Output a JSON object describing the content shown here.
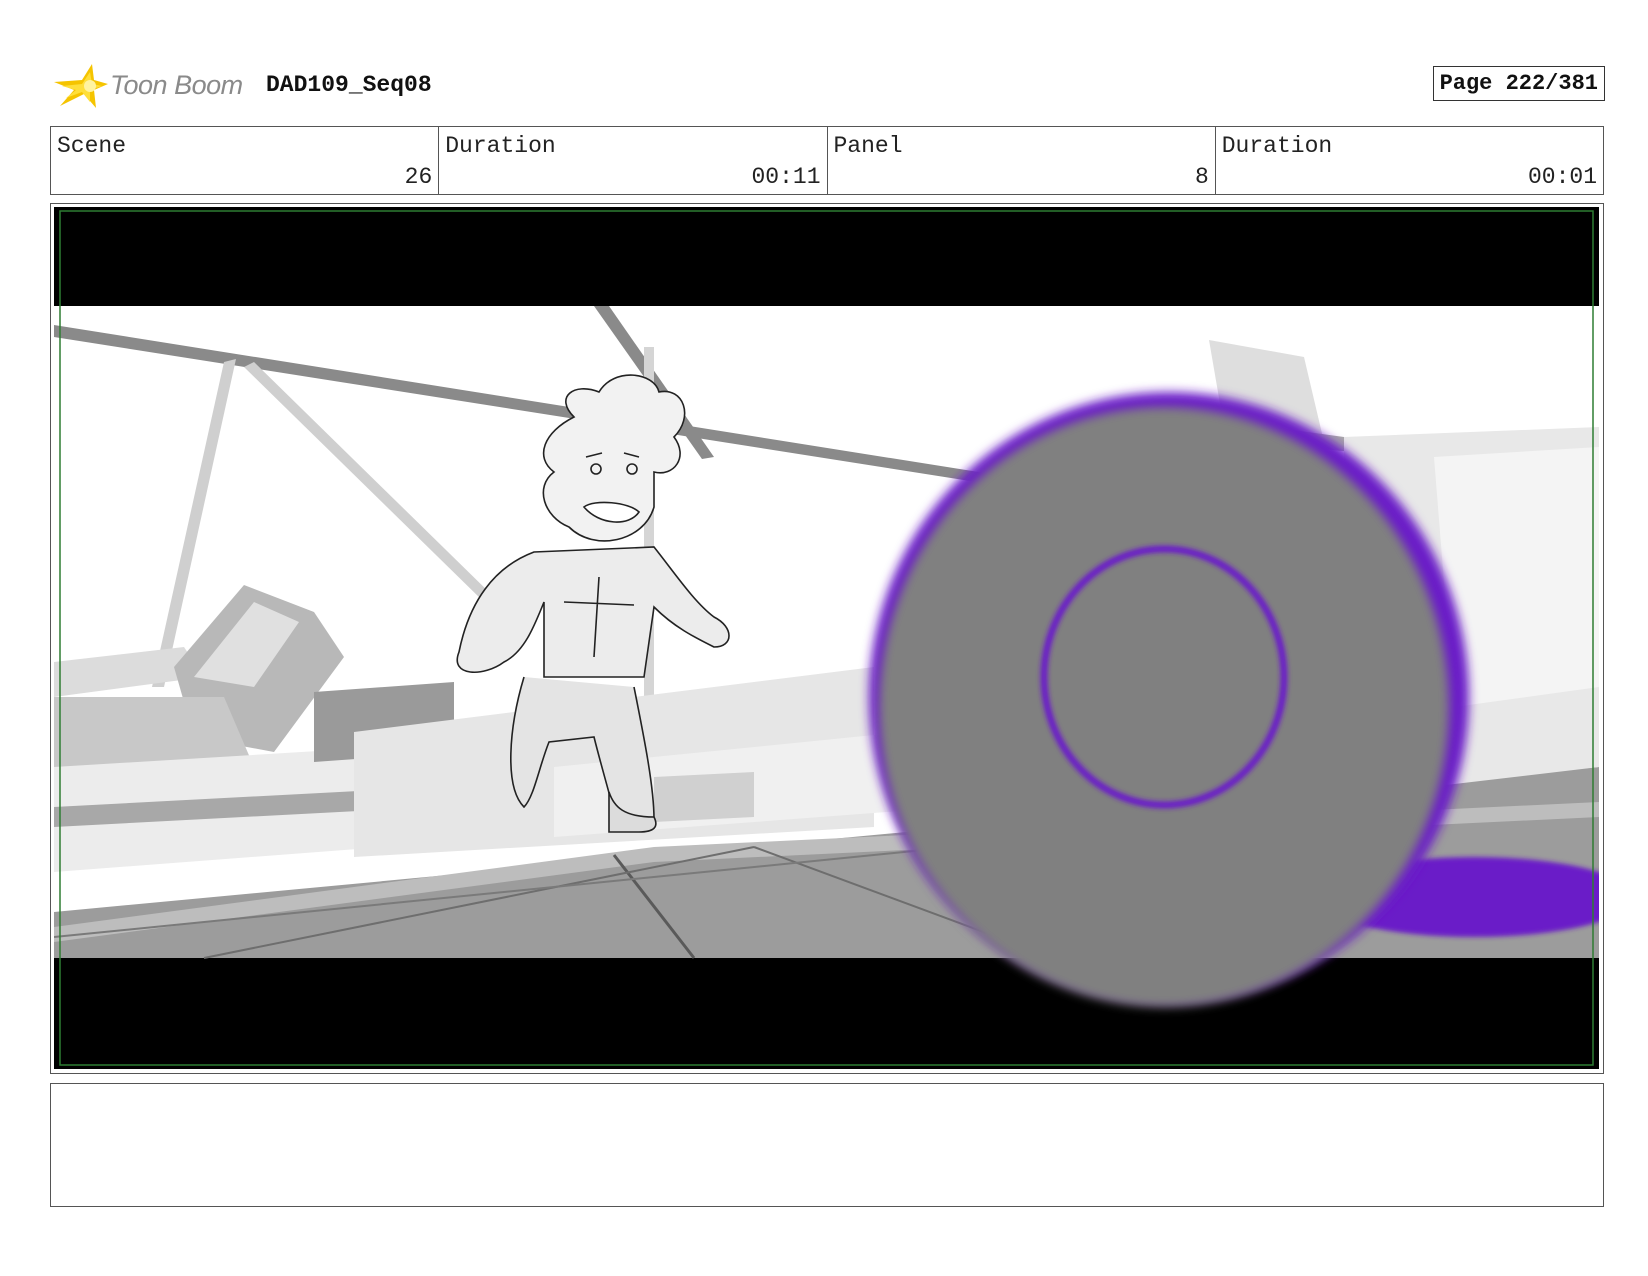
{
  "header": {
    "logo_text": "Toon Boom",
    "project_title": "DAD109_Seq08",
    "page_label": "Page 222/381"
  },
  "info": {
    "scene_label": "Scene",
    "scene_value": "26",
    "scene_duration_label": "Duration",
    "scene_duration_value": "00:11",
    "panel_label": "Panel",
    "panel_value": "8",
    "panel_duration_label": "Duration",
    "panel_duration_value": "00:01"
  },
  "notes": {
    "text": ""
  },
  "colors": {
    "safe_area_border": "#2e7d32",
    "purple_accent": "#6a1fc8",
    "logo_yellow": "#f5c400"
  },
  "icons": {
    "logo": "toon-boom-star-icon"
  }
}
